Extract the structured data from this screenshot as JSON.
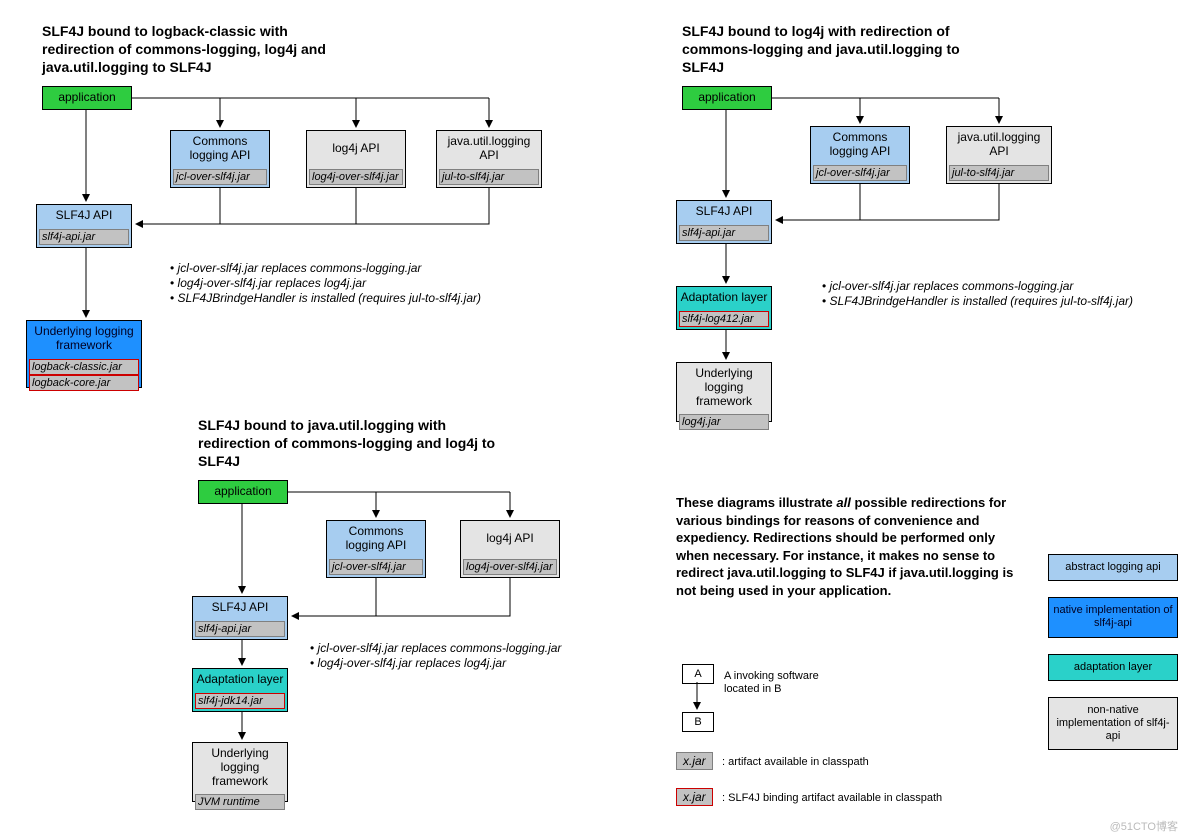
{
  "diag1": {
    "title": "SLF4J bound to logback-classic with redirection of commons-logging, log4j and java.util.logging to SLF4J",
    "app": "application",
    "commons": "Commons logging API",
    "commons_jar": "jcl-over-slf4j.jar",
    "log4j": "log4j API",
    "log4j_jar": "log4j-over-slf4j.jar",
    "jul": "java.util.logging API",
    "jul_jar": "jul-to-slf4j.jar",
    "slf4j": "SLF4J API",
    "slf4j_jar": "slf4j-api.jar",
    "underlying": "Underlying logging framework",
    "logback1": "logback-classic.jar",
    "logback2": "logback-core.jar",
    "n1": "jcl-over-slf4j.jar replaces commons-logging.jar",
    "n2": "log4j-over-slf4j.jar replaces log4j.jar",
    "n3": "SLF4JBrindgeHandler is installed (requires jul-to-slf4j.jar)"
  },
  "diag2": {
    "title": "SLF4J bound to java.util.logging with redirection of commons-logging and log4j to SLF4J",
    "app": "application",
    "commons": "Commons logging API",
    "commons_jar": "jcl-over-slf4j.jar",
    "log4j": "log4j API",
    "log4j_jar": "log4j-over-slf4j.jar",
    "slf4j": "SLF4J API",
    "slf4j_jar": "slf4j-api.jar",
    "adapt": "Adaptation layer",
    "adapt_jar": "slf4j-jdk14.jar",
    "underlying": "Underlying logging framework",
    "underlying_jar": "JVM runtime",
    "n1": "jcl-over-slf4j.jar replaces commons-logging.jar",
    "n2": "log4j-over-slf4j.jar replaces log4j.jar"
  },
  "diag3": {
    "title": "SLF4J bound to log4j with redirection of commons-logging and java.util.logging to SLF4J",
    "app": "application",
    "commons": "Commons logging API",
    "commons_jar": "jcl-over-slf4j.jar",
    "jul": "java.util.logging API",
    "jul_jar": "jul-to-slf4j.jar",
    "slf4j": "SLF4J API",
    "slf4j_jar": "slf4j-api.jar",
    "adapt": "Adaptation layer",
    "adapt_jar": "slf4j-log412.jar",
    "underlying": "Underlying logging framework",
    "underlying_jar": "log4j.jar",
    "n1": "jcl-over-slf4j.jar replaces commons-logging.jar",
    "n2": "SLF4JBrindgeHandler is installed (requires jul-to-slf4j.jar)"
  },
  "explain": "These diagrams illustrate all possible redirections for various bindings for reasons of convenience and expediency. Redirections should be performed only when necessary. For instance, it makes no sense to redirect java.util.logging to SLF4J if java.util.logging is not being used in your application.",
  "legend": {
    "abstract": "abstract logging api",
    "native": "native implementation of slf4j-api",
    "adapt": "adaptation layer",
    "nonnative": "non-native implementation of slf4j-api",
    "A": "A",
    "B": "B",
    "ab_text": "A invoking software located in B",
    "xjar": "x.jar",
    "xjar_text": ": artifact available in classpath",
    "xjar_red": "x.jar",
    "xjar_red_text": ": SLF4J binding artifact available in classpath"
  },
  "watermark": "@51CTO博客"
}
